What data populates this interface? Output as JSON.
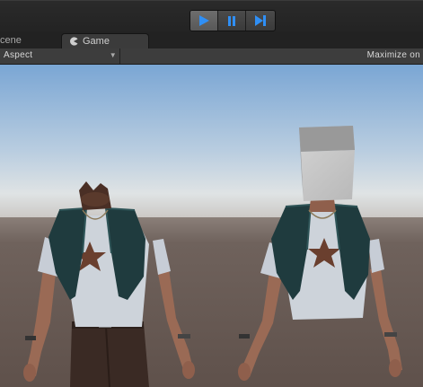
{
  "toolbar": {
    "play_icon": "play-icon",
    "pause_icon": "pause-icon",
    "step_icon": "step-icon",
    "accent": "#2f8ff5"
  },
  "tabs": {
    "scene_label": "cene",
    "game_label": "Game"
  },
  "gamebar": {
    "aspect_label": "Aspect",
    "maximize_label": "Maximize on"
  },
  "viewport": {
    "sky_top": "#7fa9d6",
    "horizon": "#d8dde0",
    "ground": "#6b5e58"
  }
}
